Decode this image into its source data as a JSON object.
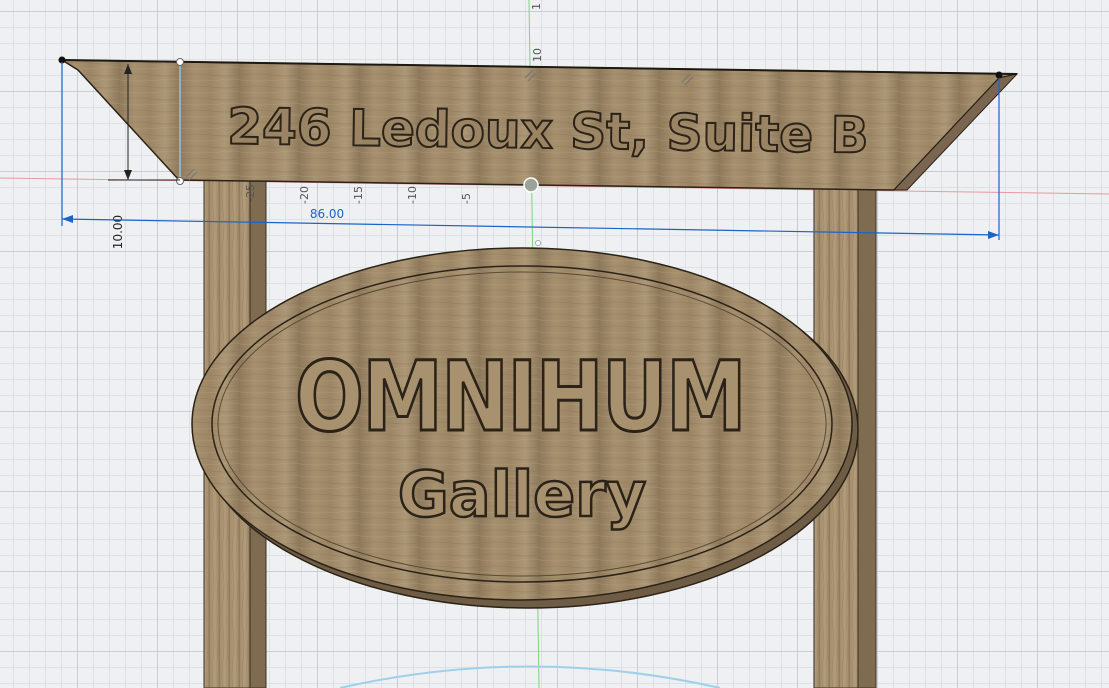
{
  "sign": {
    "address": "246 Ledoux St, Suite B",
    "brand": "OMNIHUM",
    "subtitle": "Gallery"
  },
  "dimensions": {
    "width_label": "86.00",
    "height_label": "10.00"
  },
  "ruler": {
    "ticks": [
      "-25",
      "-20",
      "-15",
      "-10",
      "-5"
    ],
    "top_label_a": "1",
    "top_label_b": "10"
  },
  "colors": {
    "wood": "#a08a6a",
    "wood_dark": "#7a6650",
    "dimension_blue": "#1a63c9",
    "axis_red": "#e89aa0",
    "axis_green": "#7fd27f",
    "grid": "#c9ced4"
  }
}
